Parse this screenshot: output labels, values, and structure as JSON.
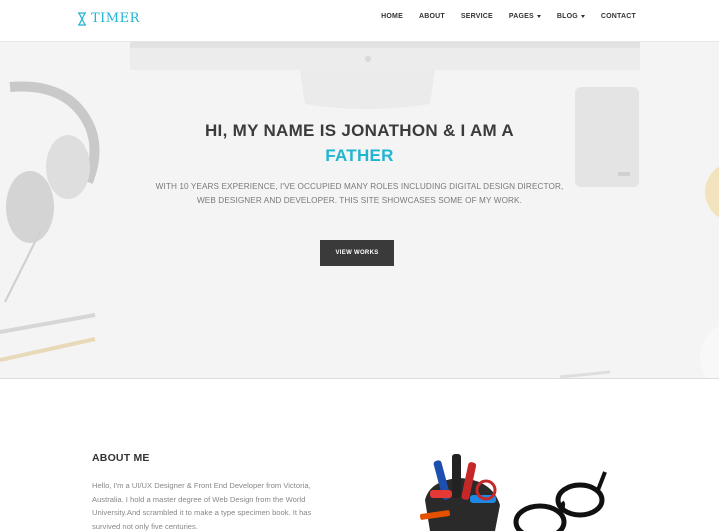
{
  "brand": {
    "name": "TIMER",
    "color": "#1fb5d1",
    "icon": "hourglass-icon"
  },
  "nav": {
    "items": [
      {
        "label": "HOME",
        "dropdown": false
      },
      {
        "label": "ABOUT",
        "dropdown": false
      },
      {
        "label": "SERVICE",
        "dropdown": false
      },
      {
        "label": "PAGES",
        "dropdown": true
      },
      {
        "label": "BLOG",
        "dropdown": true
      },
      {
        "label": "CONTACT",
        "dropdown": false
      }
    ]
  },
  "hero": {
    "title": "HI, MY NAME IS JONATHON & I AM A",
    "accent": "FATHER",
    "description": "WITH 10 YEARS EXPERIENCE, I'VE OCCUPIED MANY ROLES INCLUDING DIGITAL DESIGN DIRECTOR, WEB DESIGNER AND DEVELOPER. THIS SITE SHOWCASES SOME OF MY WORK.",
    "button": "VIEW WORKS"
  },
  "about": {
    "title": "ABOUT ME",
    "text": "Hello, I'm a UI/UX Designer & Front End Developer from Victoria, Australia. I hold a master degree of Web Design from the World University.And scrambled it to make a type specimen book. It has survived not only five centuries."
  },
  "colors": {
    "accent": "#1fb5d1",
    "button": "#3a3a3a",
    "heading": "#3b3b3b"
  }
}
